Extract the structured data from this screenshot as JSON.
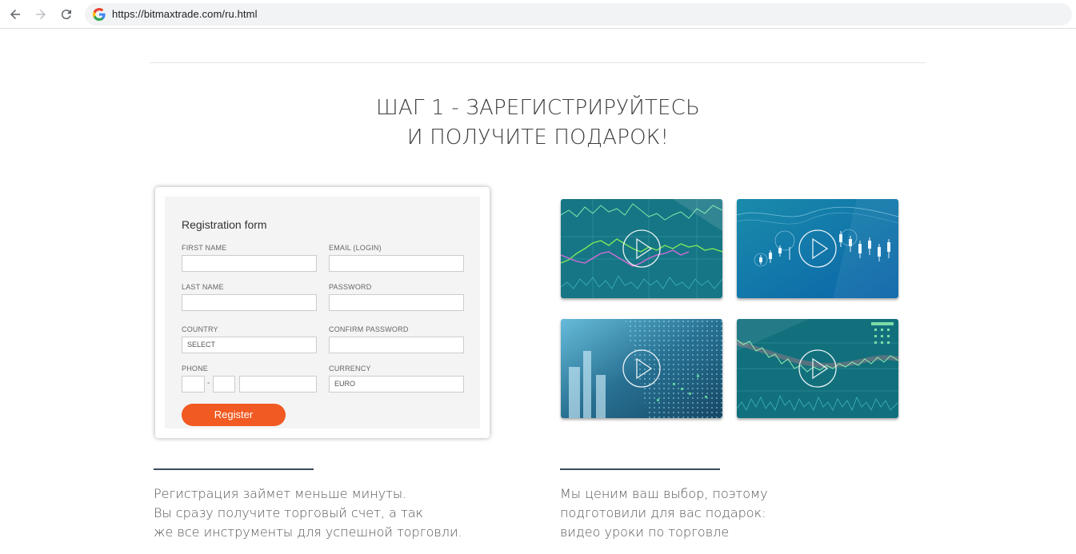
{
  "browser": {
    "url": "https://bitmaxtrade.com/ru.html",
    "back_icon": "back-arrow-icon",
    "forward_icon": "forward-arrow-icon",
    "reload_icon": "reload-icon",
    "site_icon": "google-g-icon"
  },
  "hero": {
    "line1": "ШАГ 1 - ЗАРЕГИСТРИРУЙТЕСЬ",
    "line2": "И ПОЛУЧИТЕ ПОДАРОК!"
  },
  "form": {
    "title": "Registration form",
    "first_name_label": "FIRST NAME",
    "email_label": "EMAIL (LOGIN)",
    "last_name_label": "LAST NAME",
    "password_label": "PASSWORD",
    "country_label": "COUNTRY",
    "country_value": "SELECT",
    "confirm_password_label": "CONFIRM PASSWORD",
    "phone_label": "PHONE",
    "phone_separator": "-",
    "currency_label": "CURRENCY",
    "currency_value": "EURO",
    "register_label": "Register"
  },
  "videos": {
    "icon": "play-icon",
    "accent": "#1a8c9a",
    "items": [
      "video-lesson-1",
      "video-lesson-2",
      "video-lesson-3",
      "video-lesson-4"
    ]
  },
  "bottom": {
    "left": [
      "Регистрация займет меньше минуты.",
      "Вы сразу получите торговый счет, а так",
      "же все инструменты для успешной торговли."
    ],
    "right": [
      "Мы ценим ваш выбор, поэтому",
      "подготовили для вас подарок:",
      "видео уроки по торговле"
    ]
  },
  "colors": {
    "brand_orange": "#f15a22",
    "divider_dark": "#3a4a5c"
  }
}
